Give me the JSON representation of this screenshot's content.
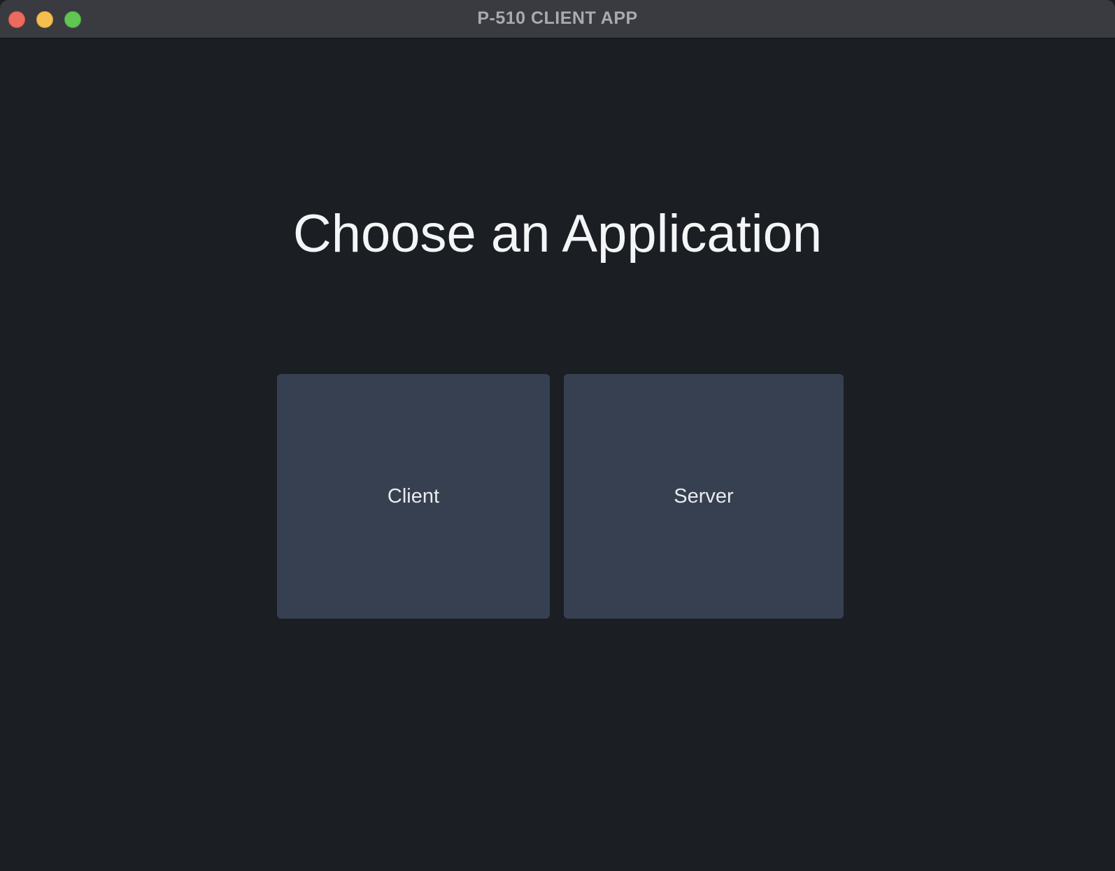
{
  "window": {
    "title": "P-510 CLIENT APP"
  },
  "main": {
    "heading": "Choose an Application",
    "options": [
      {
        "label": "Client"
      },
      {
        "label": "Server"
      }
    ]
  },
  "colors": {
    "background": "#1b1e23",
    "titlebar": "#3a3b40",
    "card": "#364050",
    "close": "#ed6a5e",
    "minimize": "#f5bf4f",
    "maximize": "#61c554"
  }
}
